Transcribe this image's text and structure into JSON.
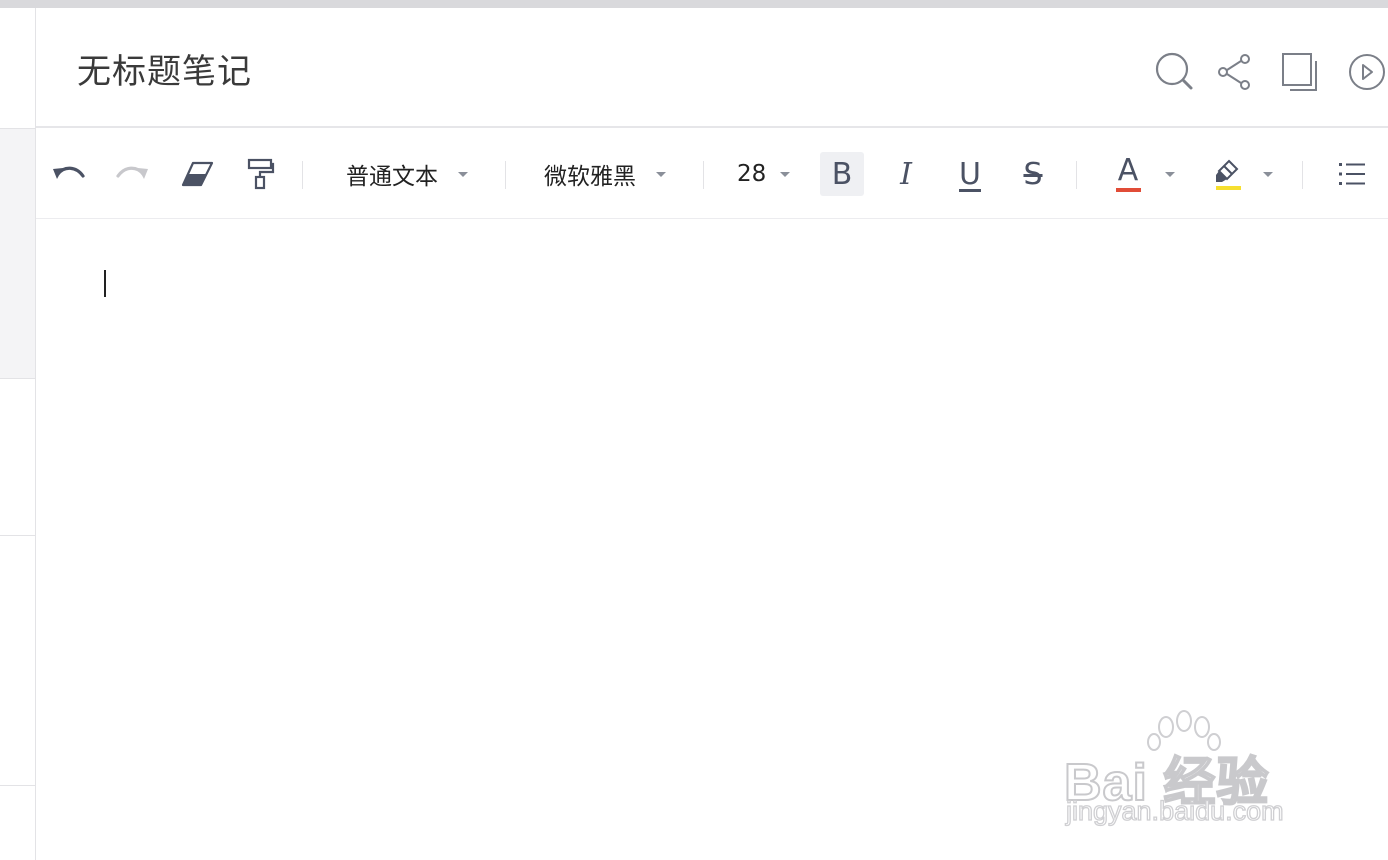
{
  "note": {
    "title": "无标题笔记"
  },
  "toolbar": {
    "paragraph_style": "普通文本",
    "font_family": "微软雅黑",
    "font_size": "28",
    "bold_label": "B",
    "italic_label": "I",
    "underline_label": "U",
    "strikethrough_label": "S",
    "text_color_label": "A"
  },
  "colors": {
    "text_color_indicator": "#e14c37",
    "highlight_color_indicator": "#f6df2f",
    "icon_color": "#4b5264",
    "disabled_icon_color": "#c8c8cc"
  },
  "icons": [
    "search-icon",
    "share-icon",
    "pages-icon",
    "play-icon",
    "undo-icon",
    "redo-icon",
    "eraser-icon",
    "format-painter-icon",
    "highlighter-icon",
    "list-icon"
  ],
  "watermark": {
    "brand": "Bai 经验",
    "url": "jingyan.baidu.com"
  }
}
